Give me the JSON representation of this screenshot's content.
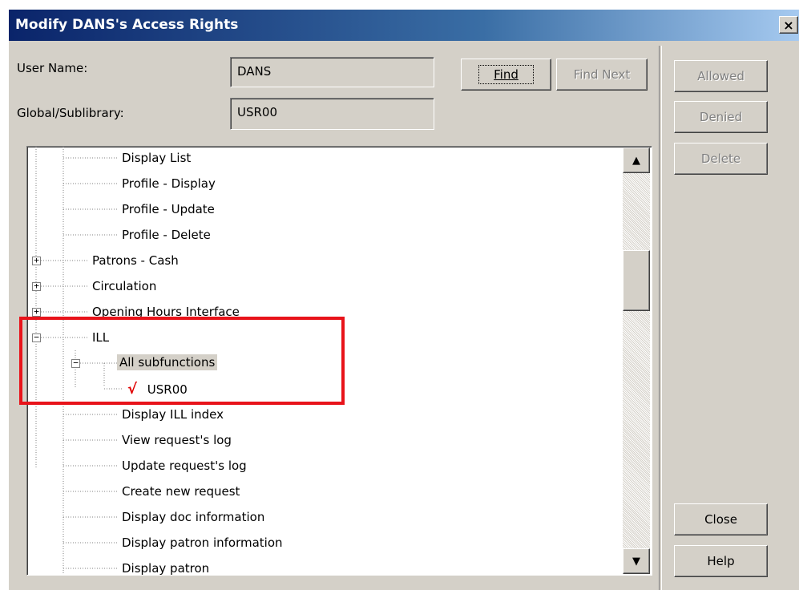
{
  "window": {
    "title": "Modify DANS's Access Rights",
    "close_glyph": "×"
  },
  "form": {
    "user_name_label": "User Name:",
    "user_name_value": "DANS",
    "global_label": "Global/Sublibrary:",
    "global_value": "USR00"
  },
  "buttons": {
    "find": "Find",
    "find_next": "Find Next",
    "allowed": "Allowed",
    "denied": "Denied",
    "delete": "Delete",
    "close": "Close",
    "help": "Help"
  },
  "tree": {
    "items": [
      {
        "label": "Display List"
      },
      {
        "label": "Profile - Display"
      },
      {
        "label": "Profile - Update"
      },
      {
        "label": "Profile - Delete"
      },
      {
        "label": "Patrons - Cash",
        "expander": "+"
      },
      {
        "label": "Circulation",
        "expander": "+"
      },
      {
        "label": "Opening Hours Interface",
        "expander": "+"
      },
      {
        "label": "ILL",
        "expander": "−"
      },
      {
        "label": "All subfunctions",
        "expander": "−"
      },
      {
        "label": "USR00",
        "check": "√"
      },
      {
        "label": "Display ILL index"
      },
      {
        "label": "View request's log"
      },
      {
        "label": "Update request's log"
      },
      {
        "label": "Create new request"
      },
      {
        "label": "Display doc information"
      },
      {
        "label": "Display patron information"
      },
      {
        "label": "Display patron"
      }
    ]
  },
  "scrollbar": {
    "up": "▲",
    "down": "▼"
  },
  "colors": {
    "title_start": "#0a246a",
    "highlight": "#e8131a",
    "check": "#e00000"
  }
}
